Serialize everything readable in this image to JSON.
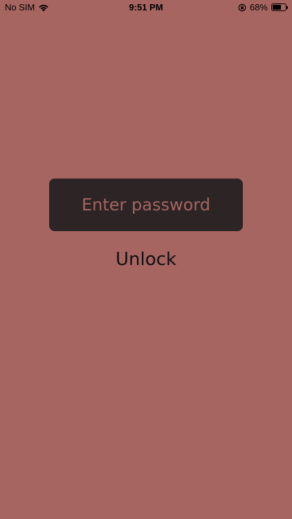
{
  "status_bar": {
    "carrier": "No SIM",
    "time": "9:51 PM",
    "battery_percent": "68%",
    "battery_level": 0.68,
    "icons": [
      "wifi-icon",
      "rotation-lock-icon",
      "battery-icon"
    ]
  },
  "password": {
    "placeholder": "Enter password",
    "value": ""
  },
  "unlock": {
    "label": "Unlock"
  },
  "colors": {
    "background": "#a66561",
    "field_background": "#2c2425",
    "placeholder_text": "#a66561",
    "button_text": "#111111"
  }
}
